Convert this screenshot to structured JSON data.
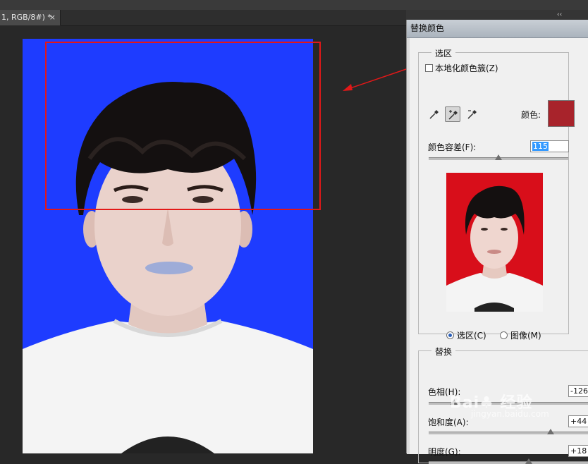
{
  "document_tab": {
    "title": "1, RGB/8#) *",
    "close_glyph": "×"
  },
  "panel_collapse_glyph": "‹‹",
  "canvas": {
    "photo_background": "#1e3cff",
    "selection_color": "#e31818"
  },
  "dialog": {
    "title": "替换颜色",
    "selection_group": {
      "legend": "选区",
      "localized_clusters": {
        "label": "本地化颜色簇(Z)",
        "checked": false
      },
      "eyedroppers": [
        "eyedropper-icon",
        "eyedropper-add-icon",
        "eyedropper-subtract-icon"
      ],
      "color_label": "颜色:",
      "color_value": "#a8232b",
      "fuzziness_label": "颜色容差(F):",
      "fuzziness_value": "115",
      "fuzziness_level": 0.5
    },
    "preview": {
      "background": "#d80e1a",
      "radio_selection": {
        "label": "选区(C)",
        "selected": true
      },
      "radio_image": {
        "label": "图像(M)",
        "selected": false
      }
    },
    "replace_group": {
      "legend": "替换",
      "hue": {
        "label": "色相(H):",
        "value": "-126",
        "level": 0.15
      },
      "saturation": {
        "label": "饱和度(A):",
        "value": "+44",
        "level": 0.72
      },
      "lightness": {
        "label": "明度(G):",
        "value": "+18",
        "level": 0.59
      }
    }
  },
  "watermark": {
    "text": "Bai♣ 经验",
    "url": "jingyan.baidu.com"
  }
}
